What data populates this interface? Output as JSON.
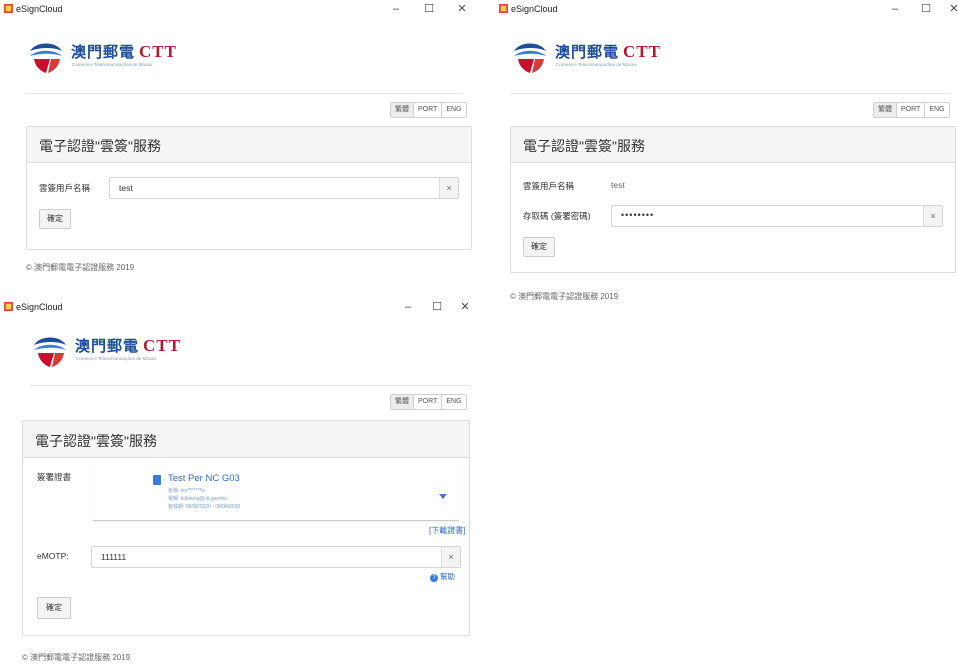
{
  "window_title": "eSignCloud",
  "window_controls": {
    "minimize": "–",
    "maximize": "☐",
    "close": "✕"
  },
  "logo": {
    "chinese": "澳門郵電",
    "ctt": "CTT",
    "subtitle": "Correios e Telecomunicações de Macau"
  },
  "lang": {
    "trad_chinese": "繁體",
    "port": "PORT",
    "eng": "ENG"
  },
  "panel_title": "電子認證\"雲簽\"服務",
  "footer": "© 澳門郵電電子認證服務 2019",
  "win1": {
    "username_label": "雲簽用戶名稱",
    "username_value": "test",
    "clear": "×",
    "confirm": "確定"
  },
  "win2": {
    "username_label": "雲簽用戶名稱",
    "username_value": "test",
    "access_code_label": "存取碼 (簽署密碼)",
    "access_code_value": "••••••••",
    "clear": "×",
    "confirm": "確定"
  },
  "win3": {
    "cert_label": "簽署證書",
    "cert": {
      "name": "Test Per NC G03",
      "row1": "名稱: tes*******ts",
      "row2": "電郵: felixlung@ctt.gov.mo",
      "row3": "有效期: 08/06/2020 - 08/06/2030"
    },
    "download_link": "[下載證書]",
    "emotp_label": "eMOTP:",
    "emotp_value": "111111",
    "clear": "×",
    "help": "幫助",
    "confirm": "確定"
  },
  "colors": {
    "brand_blue": "#1e4d9b",
    "brand_red": "#b01c2e",
    "link_blue": "#2f6cc7"
  }
}
